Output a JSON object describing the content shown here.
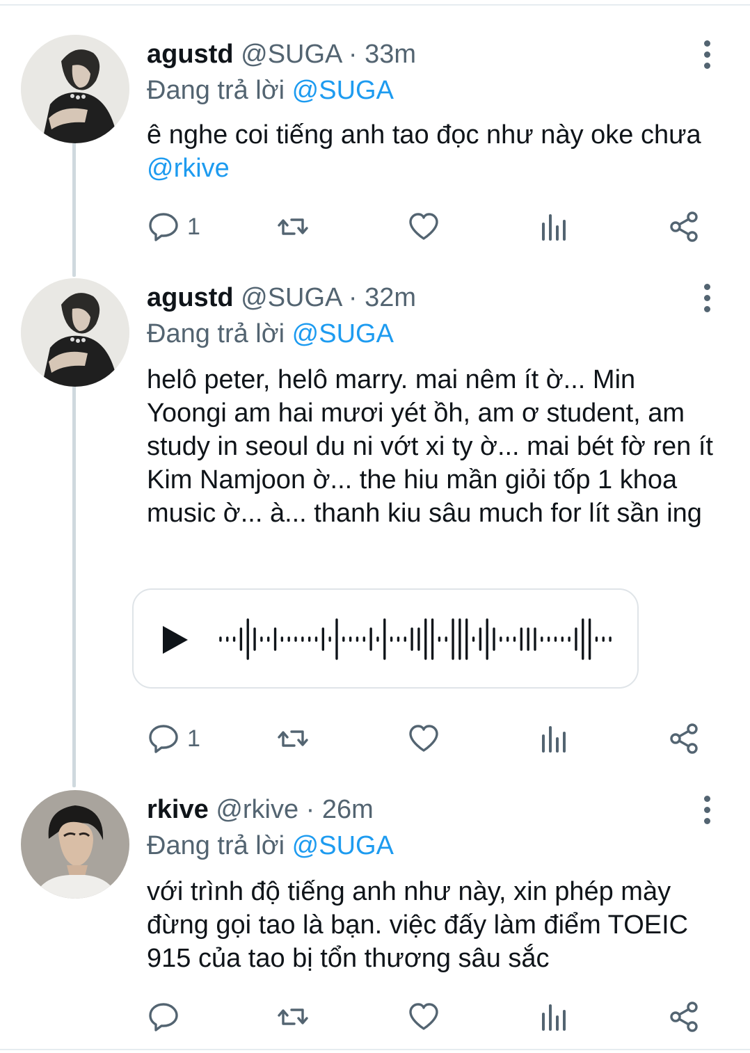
{
  "tweets": [
    {
      "name": "agustd",
      "handle": "@SUGA",
      "sep": " · ",
      "time": "33m",
      "replying_prefix": "Đang trả lời ",
      "replying_to": "@SUGA",
      "text": "ê nghe coi tiếng anh tao đọc như này oke chưa ",
      "text_mention": "@rkive",
      "reply_count": "1",
      "icons": [
        "reply-icon",
        "retweet-icon",
        "like-icon",
        "analytics-icon",
        "share-icon",
        "more-icon"
      ]
    },
    {
      "name": "agustd",
      "handle": "@SUGA",
      "sep": " · ",
      "time": "32m",
      "replying_prefix": "Đang trả lời ",
      "replying_to": "@SUGA",
      "text": "helô peter, helô marry. mai nêm ít ờ... Min Yoongi am hai mươi yét ồh, am ơ student, am study in seoul du ni vớt xi ty ờ... mai bét fờ ren ít Kim Namjoon ờ... the hiu mần giỏi tốp 1 khoa music ờ... à... thanh kiu sâu much for lít sần ing",
      "reply_count": "1",
      "audio": {
        "icon": "play-icon"
      }
    },
    {
      "name": "rkive",
      "handle": "@rkive",
      "sep": " · ",
      "time": "26m",
      "replying_prefix": "Đang trả lời ",
      "replying_to": "@SUGA",
      "text": "với trình độ tiếng anh như này, xin phép mày đừng gọi tao là bạn. việc đấy làm điểm TOEIC 915 của tao bị tổn thương sâu sắc",
      "reply_count": ""
    }
  ],
  "colors": {
    "accent": "#1d9bf0",
    "muted": "#536471",
    "text": "#0f1419",
    "thread": "#cfd9de"
  }
}
